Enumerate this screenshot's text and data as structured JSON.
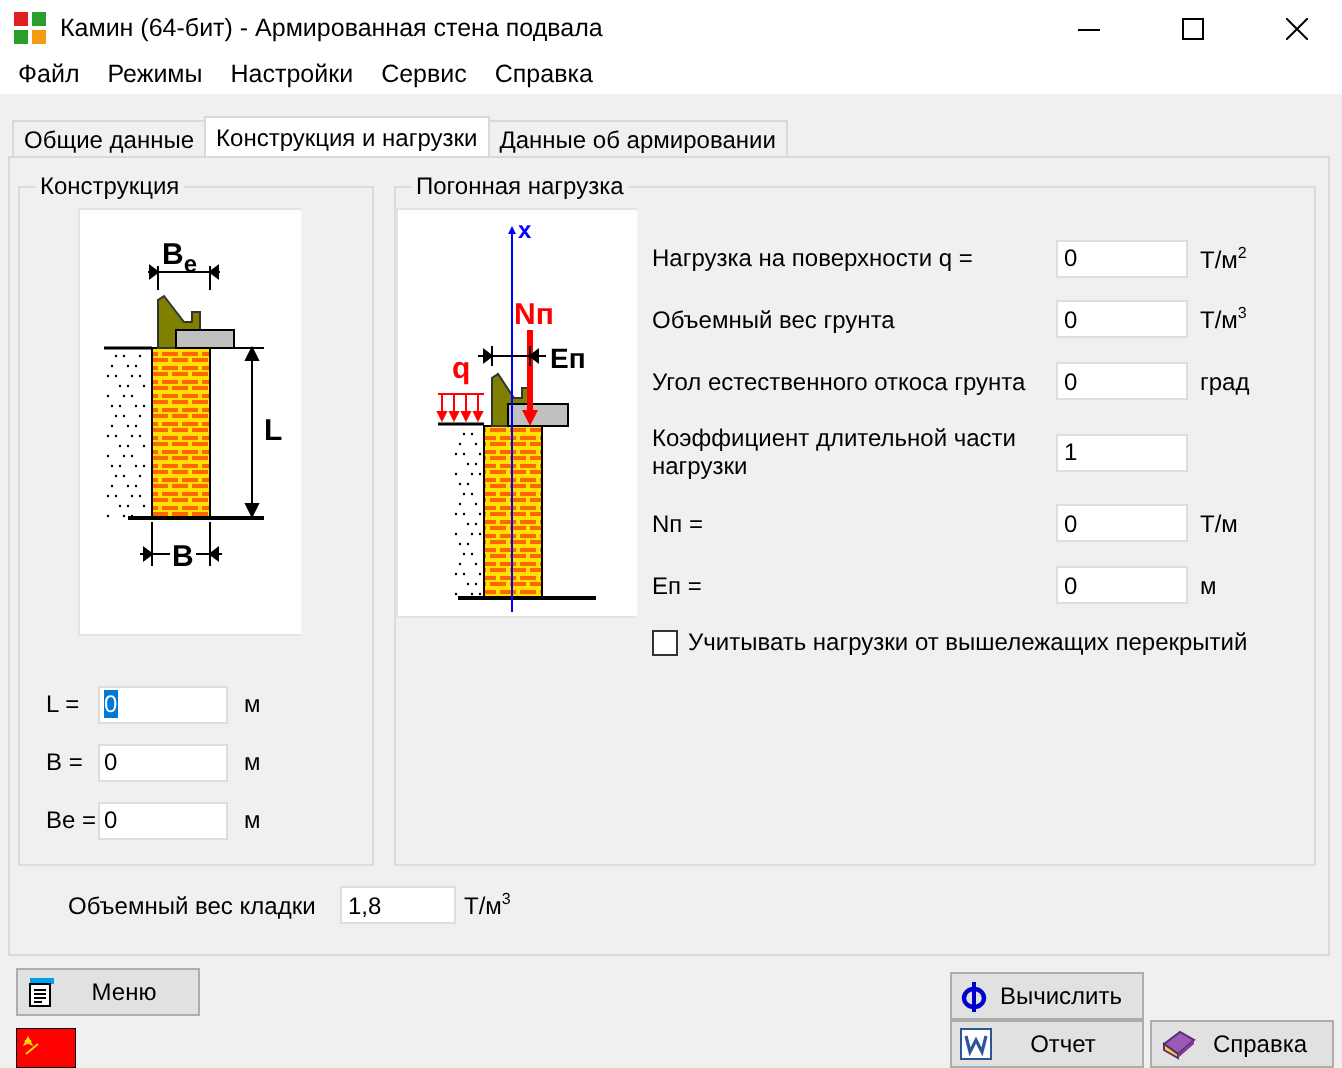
{
  "window": {
    "title": "Камин (64-бит) - Армированная стена подвала"
  },
  "menu": [
    "Файл",
    "Режимы",
    "Настройки",
    "Сервис",
    "Справка"
  ],
  "tabs": [
    {
      "label": "Общие данные",
      "selected": false
    },
    {
      "label": "Конструкция и нагрузки",
      "selected": true
    },
    {
      "label": "Данные об армировании",
      "selected": false
    }
  ],
  "construction": {
    "title": "Конструкция",
    "diagram_labels": {
      "top_width": "B$_{e}$",
      "height": "L",
      "width": "B"
    },
    "fields": [
      {
        "label": "L =",
        "value": "0",
        "unit": "м",
        "selected": true
      },
      {
        "label": "B =",
        "value": "0",
        "unit": "м",
        "selected": false
      },
      {
        "label": "Be =",
        "value": "0",
        "unit": "м",
        "selected": false
      }
    ]
  },
  "load": {
    "title": "Погонная нагрузка",
    "diagram_labels": {
      "axis": "x",
      "force": "Nп",
      "eccentricity": "Eп",
      "surface_load": "q"
    },
    "fields": [
      {
        "label": "Нагрузка на поверхности q =",
        "value": "0",
        "unit": "Т/м$^{2}$"
      },
      {
        "label": "Объемный вес грунта",
        "value": "0",
        "unit": "Т/м$^{3}$"
      },
      {
        "label": "Угол естественного откоса грунта",
        "value": "0",
        "unit": "град"
      },
      {
        "label": "Коэффициент длительной части нагрузки",
        "value": "1"
      },
      {
        "label": "Nп =",
        "value": "0",
        "unit": "Т/м"
      },
      {
        "label": "Еп =",
        "value": "0",
        "unit": "м"
      }
    ],
    "checkbox": {
      "label": "Учитывать нагрузки от вышележащих перекрытий",
      "checked": false
    }
  },
  "masonry": {
    "label": "Объемный вес кладки",
    "value": "1,8",
    "unit": "Т/м$^{3}$"
  },
  "buttons": {
    "menu": "Меню",
    "calculate": "Вычислить",
    "report": "Отчет",
    "help": "Справка"
  }
}
